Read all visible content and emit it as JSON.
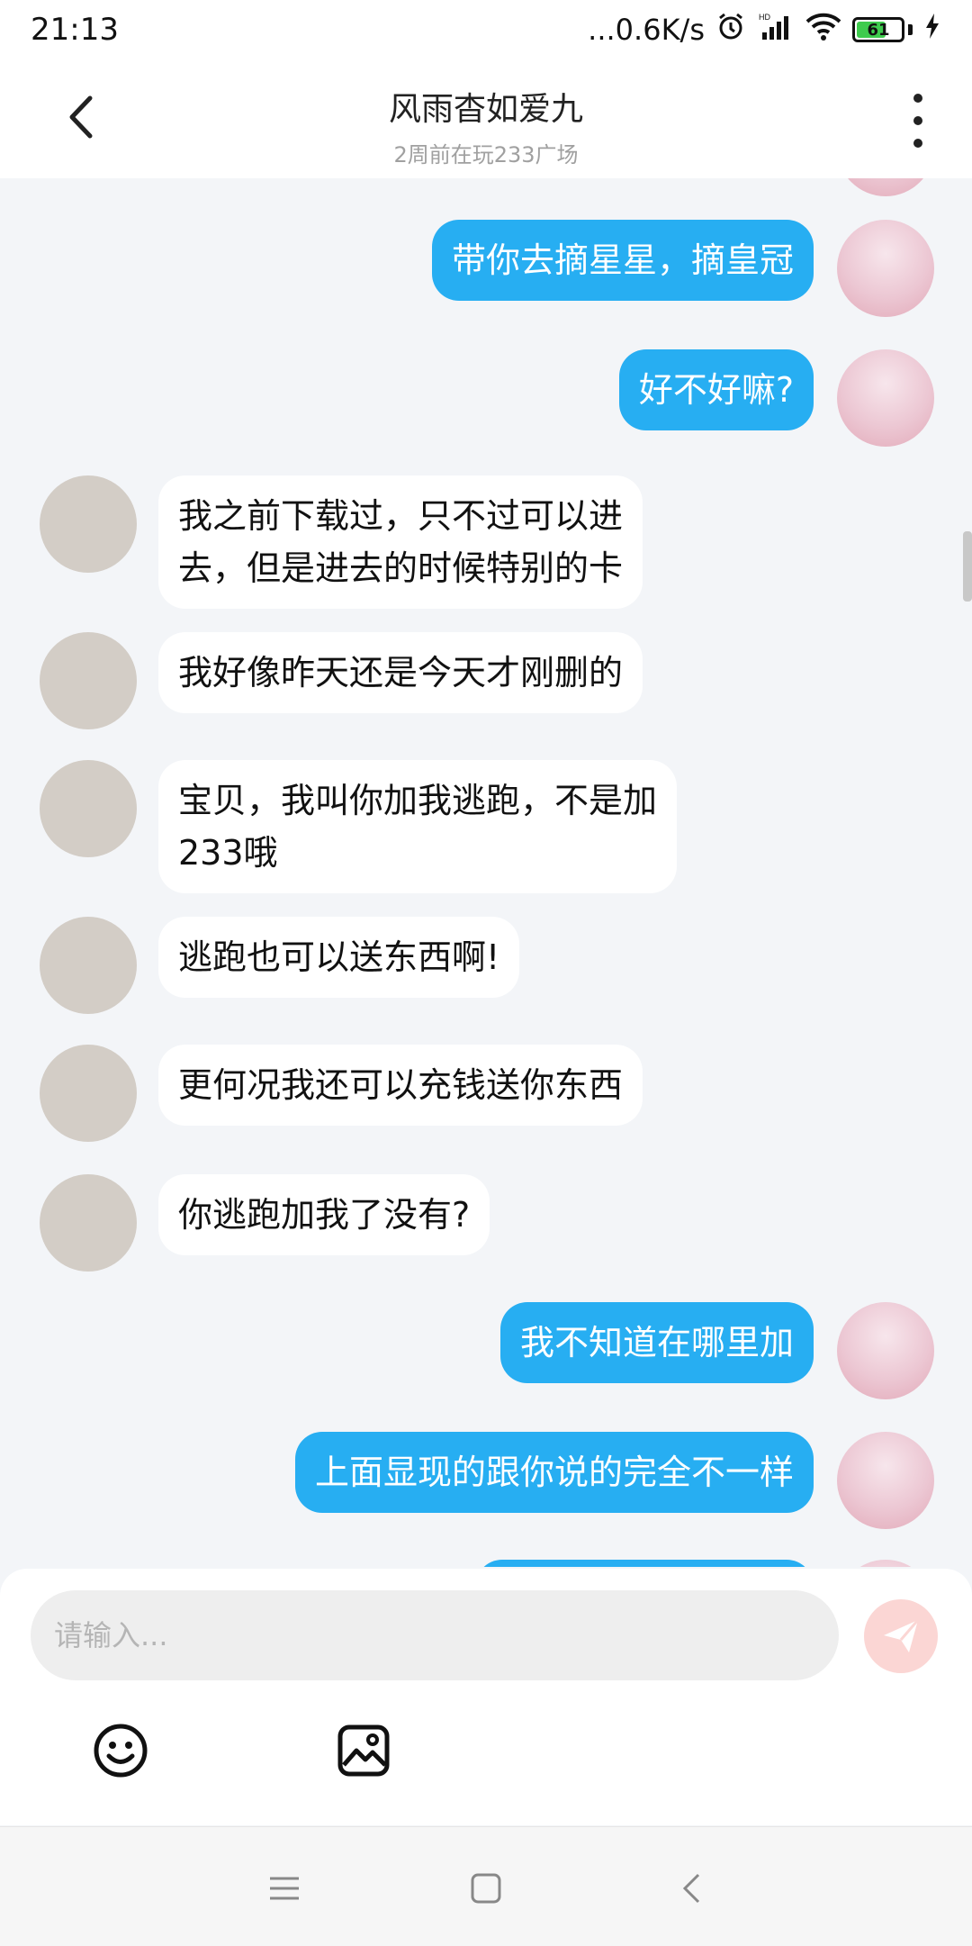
{
  "status_bar": {
    "time": "21:13",
    "net_speed": "...0.6K/s",
    "battery": "61"
  },
  "header": {
    "title": "风雨杳如爱九",
    "subtitle": "2周前在玩233广场"
  },
  "messages": [
    {
      "sender": "me",
      "text": "带你去摘星星，摘皇冠"
    },
    {
      "sender": "me",
      "text": "好不好嘛?"
    },
    {
      "sender": "other",
      "lines": [
        "我之前下载过，只不过可以进",
        "去，但是进去的时候特别的卡"
      ]
    },
    {
      "sender": "other",
      "text": "我好像昨天还是今天才刚删的"
    },
    {
      "sender": "other",
      "lines": [
        "宝贝，我叫你加我逃跑，不是加",
        "233哦"
      ]
    },
    {
      "sender": "other",
      "text": "逃跑也可以送东西啊!"
    },
    {
      "sender": "other",
      "text": "更何况我还可以充钱送你东西"
    },
    {
      "sender": "other",
      "text": "你逃跑加我了没有?"
    },
    {
      "sender": "me",
      "text": "我不知道在哪里加"
    },
    {
      "sender": "me",
      "text": "上面显现的跟你说的完全不一样"
    }
  ],
  "input": {
    "placeholder": "请输入..."
  },
  "colors": {
    "my_bubble": "#27aef2",
    "other_bubble": "#ffffff",
    "background": "#f3f5f8",
    "send_button": "#fbd6d4"
  },
  "icons": {
    "back": "chevron-left-icon",
    "more": "more-vertical-icon",
    "send": "send-icon",
    "emoji": "smiley-icon",
    "image": "image-icon"
  }
}
